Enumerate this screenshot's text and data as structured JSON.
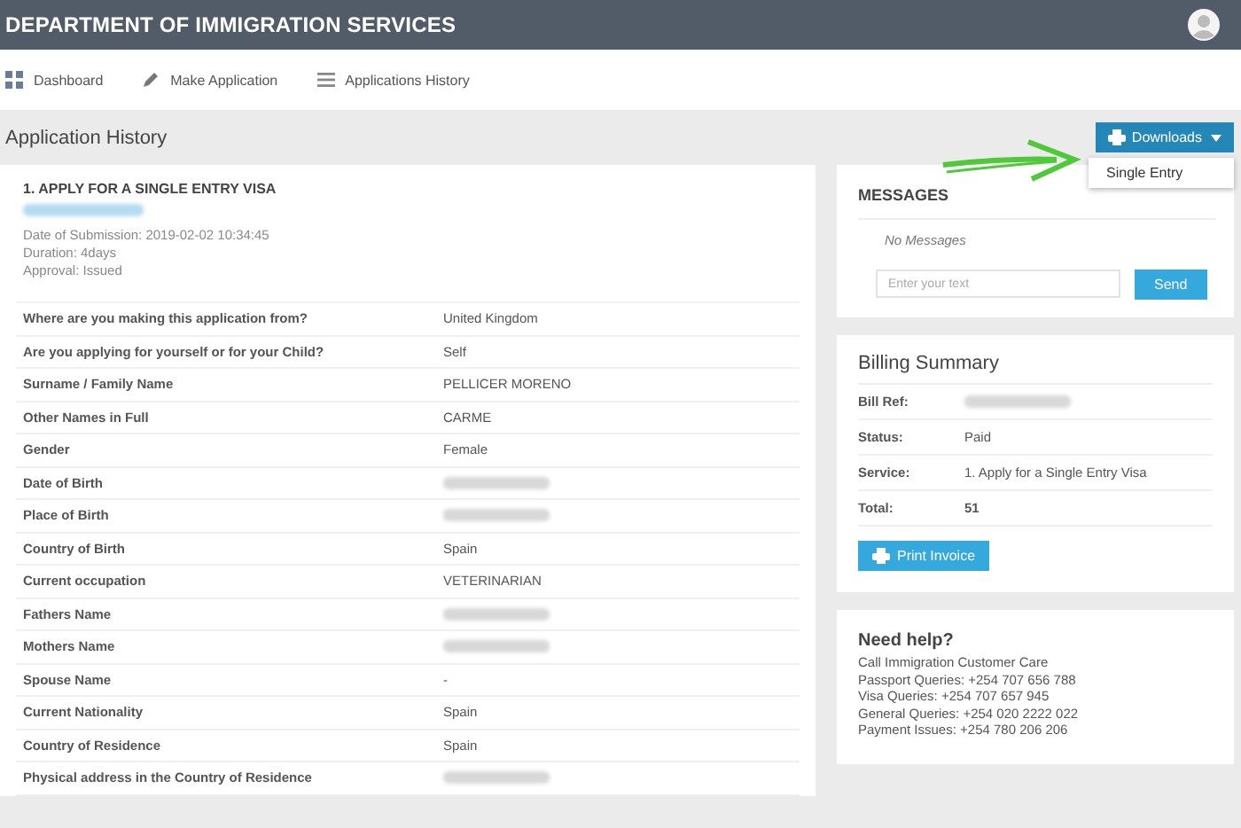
{
  "header": {
    "title": "DEPARTMENT OF IMMIGRATION SERVICES"
  },
  "nav": [
    {
      "label": "Dashboard"
    },
    {
      "label": "Make Application"
    },
    {
      "label": "Applications History"
    }
  ],
  "page_title": "Application History",
  "downloads": {
    "label": "Downloads",
    "expanded": true,
    "menu": [
      "Single Entry"
    ]
  },
  "application": {
    "title": "1. APPLY FOR A SINGLE ENTRY VISA",
    "meta": [
      "Date of Submission: 2019-02-02 10:34:45",
      "Duration: 4days",
      "Approval: Issued"
    ],
    "rows": [
      {
        "label": "Where are you making this application from?",
        "value": "United Kingdom",
        "redacted": false
      },
      {
        "label": "Are you applying for yourself or for your Child?",
        "value": "Self",
        "redacted": false
      },
      {
        "label": "Surname / Family Name",
        "value": "PELLICER MORENO",
        "redacted": false
      },
      {
        "label": "Other Names in Full",
        "value": "CARME",
        "redacted": false
      },
      {
        "label": "Gender",
        "value": "Female",
        "redacted": false
      },
      {
        "label": "Date of Birth",
        "redacted": true
      },
      {
        "label": "Place of Birth",
        "redacted": true
      },
      {
        "label": "Country of Birth",
        "value": "Spain",
        "redacted": false
      },
      {
        "label": "Current occupation",
        "value": "VETERINARIAN",
        "redacted": false
      },
      {
        "label": "Fathers Name",
        "redacted": true
      },
      {
        "label": "Mothers Name",
        "redacted": true
      },
      {
        "label": "Spouse Name",
        "value": "-",
        "redacted": false
      },
      {
        "label": "Current Nationality",
        "value": "Spain",
        "redacted": false
      },
      {
        "label": "Country of Residence",
        "value": "Spain",
        "redacted": false
      },
      {
        "label": "Physical address in the Country of Residence",
        "redacted": true
      }
    ]
  },
  "messages": {
    "title": "MESSAGES",
    "empty_text": "No Messages",
    "input": {
      "placeholder": "Enter your text"
    },
    "send": "Send"
  },
  "billing": {
    "title": "Billing Summary",
    "rows": [
      {
        "label": "Bill Ref:",
        "redacted": true
      },
      {
        "label": "Status:",
        "value": "Paid",
        "redacted": false
      },
      {
        "label": "Service:",
        "value": "1. Apply for a Single Entry Visa",
        "redacted": false
      },
      {
        "label": "Total:",
        "value": "51",
        "redacted": false,
        "bold": true
      }
    ],
    "print": "Print Invoice"
  },
  "help": {
    "title": "Need help?",
    "lines": [
      "Call Immigration Customer Care",
      "Passport Queries: +254 707 656 788",
      "Visa Queries: +254 707 657 945",
      "General Queries: +254 020 2222 022",
      "Payment Issues: +254 780 206 206"
    ]
  }
}
